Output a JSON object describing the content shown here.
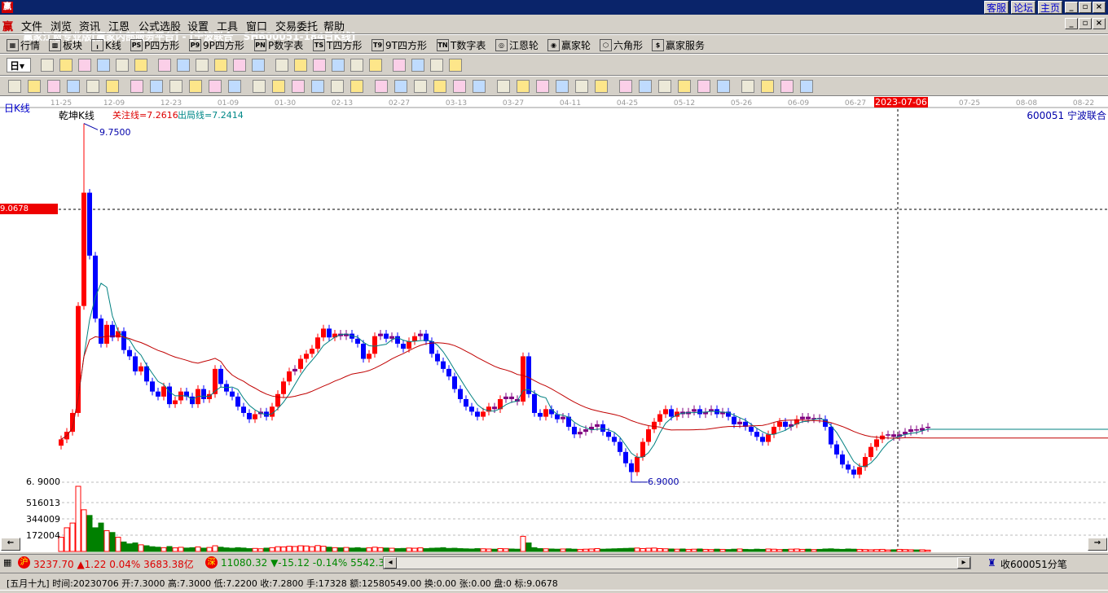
{
  "title": {
    "text": "赢家江恩专业版[赢家内部服务平台] - [宁波联合   SH600051-184日K线]",
    "logo": "赢",
    "links": [
      "客服",
      "论坛",
      "主页"
    ]
  },
  "menu": {
    "logo": "赢",
    "items": [
      "文件",
      "浏览",
      "资讯",
      "江恩",
      "公式选股",
      "设置",
      "工具",
      "窗口",
      "交易委托",
      "帮助"
    ]
  },
  "toolbar1": [
    {
      "icon": "quote-table-icon",
      "label": "行情",
      "tag": "▦"
    },
    {
      "icon": "sector-icon",
      "label": "板块",
      "tag": "▩"
    },
    {
      "icon": "kline-icon",
      "label": "K线",
      "tag": "╻"
    },
    {
      "icon": "p-square-icon",
      "label": "P四方形",
      "tag": "PS"
    },
    {
      "icon": "p9-square-icon",
      "label": "9P四方形",
      "tag": "P9"
    },
    {
      "icon": "p-number-table-icon",
      "label": "P数字表",
      "tag": "PN"
    },
    {
      "icon": "t-square-icon",
      "label": "T四方形",
      "tag": "TS"
    },
    {
      "icon": "t9-square-icon",
      "label": "9T四方形",
      "tag": "T9"
    },
    {
      "icon": "t-number-table-icon",
      "label": "T数字表",
      "tag": "TN"
    },
    {
      "icon": "gann-wheel-icon",
      "label": "江恩轮",
      "tag": "◎"
    },
    {
      "icon": "winner-wheel-icon",
      "label": "赢家轮",
      "tag": "◉"
    },
    {
      "icon": "hexagon-icon",
      "label": "六角形",
      "tag": "⬡"
    },
    {
      "icon": "dollar-icon",
      "label": "赢家服务",
      "tag": "$"
    }
  ],
  "toolbar2_period": "日",
  "chart": {
    "period_label": "日K线",
    "indicator_name": "乾坤K线",
    "focus_line": "关注线=7.2616",
    "exit_line": "出局线=7.2414",
    "stock": "600051  宁波联合",
    "date_ticks": [
      "11-25",
      "12-09",
      "12-23",
      "01-09",
      "01-30",
      "02-13",
      "02-27",
      "03-13",
      "03-27",
      "04-11",
      "04-25",
      "05-12",
      "05-26",
      "06-09",
      "06-27",
      "07-25",
      "08-08",
      "08-22"
    ],
    "cursor_date": "2023-07-06",
    "cursor_price": "9.0678",
    "high_label": "9.7500",
    "low_label": "6.9000",
    "low_axis_label": "6. 9000",
    "volume_ticks": [
      "516013",
      "344009",
      "172004"
    ],
    "colors": {
      "up": "#ff0000",
      "down": "#0000ff",
      "neutral": "#800080",
      "ma_fast": "#008080",
      "ma_slow": "#c00000",
      "vol_up": "#ff0000",
      "vol_down": "#008000"
    }
  },
  "chart_data": {
    "type": "candlestick",
    "title": "宁波联合 SH600051 日K线",
    "ylim": [
      6.9,
      9.75
    ],
    "closes": [
      7.24,
      7.3,
      7.45,
      8.3,
      9.2,
      8.7,
      8.2,
      8.0,
      8.15,
      8.05,
      8.1,
      7.95,
      7.9,
      7.78,
      7.82,
      7.7,
      7.62,
      7.58,
      7.66,
      7.52,
      7.55,
      7.62,
      7.58,
      7.52,
      7.64,
      7.56,
      7.6,
      7.8,
      7.68,
      7.62,
      7.58,
      7.5,
      7.45,
      7.4,
      7.44,
      7.46,
      7.42,
      7.5,
      7.6,
      7.7,
      7.78,
      7.8,
      7.88,
      7.92,
      7.96,
      8.05,
      8.12,
      8.05,
      8.08,
      8.06,
      8.08,
      8.04,
      8.0,
      7.88,
      7.92,
      8.06,
      8.08,
      8.04,
      8.06,
      8.0,
      7.96,
      8.02,
      8.06,
      8.08,
      8.02,
      7.92,
      7.86,
      7.8,
      7.74,
      7.64,
      7.56,
      7.5,
      7.46,
      7.42,
      7.46,
      7.5,
      7.48,
      7.56,
      7.58,
      7.56,
      7.54,
      7.9,
      7.6,
      7.45,
      7.42,
      7.48,
      7.44,
      7.4,
      7.42,
      7.34,
      7.28,
      7.3,
      7.32,
      7.34,
      7.36,
      7.3,
      7.26,
      7.22,
      7.14,
      7.05,
      6.98,
      7.1,
      7.22,
      7.32,
      7.38,
      7.44,
      7.48,
      7.42,
      7.46,
      7.44,
      7.46,
      7.48,
      7.44,
      7.46,
      7.48,
      7.44,
      7.46,
      7.42,
      7.36,
      7.38,
      7.34,
      7.3,
      7.26,
      7.22,
      7.28,
      7.34,
      7.38,
      7.34,
      7.36,
      7.4,
      7.42,
      7.4,
      7.41,
      7.4,
      7.34,
      7.2,
      7.12,
      7.04,
      7.0,
      6.96,
      7.02,
      7.1,
      7.18,
      7.24,
      7.27,
      7.28,
      7.26,
      7.28,
      7.3,
      7.32,
      7.31,
      7.33,
      7.34
    ],
    "volumes": [
      150000,
      250000,
      300000,
      688000,
      440000,
      380000,
      250000,
      300000,
      220000,
      200000,
      150000,
      100000,
      80000,
      90000,
      70000,
      60000,
      50000,
      45000,
      40000,
      52000,
      38000,
      44000,
      36000,
      40000,
      48000,
      35000,
      42000,
      60000,
      45000,
      38000,
      34000,
      40000,
      36000,
      30000,
      32000,
      28000,
      35000,
      40000,
      50000,
      48000,
      55000,
      52000,
      60000,
      58000,
      50000,
      62000,
      55000,
      45000,
      40000,
      38000,
      42000,
      36000,
      40000,
      34000,
      38000,
      45000,
      40000,
      36000,
      34000,
      30000,
      32000,
      36000,
      34000,
      38000,
      30000,
      34000,
      36000,
      40000,
      32000,
      34000,
      30000,
      28000,
      26000,
      30000,
      28000,
      26000,
      24000,
      30000,
      28000,
      26000,
      24000,
      160000,
      90000,
      40000,
      30000,
      28000,
      26000,
      24000,
      26000,
      28000,
      24000,
      22000,
      24000,
      26000,
      30000,
      24000,
      26000,
      28000,
      30000,
      32000,
      34000,
      36000,
      30000,
      34000,
      36000,
      30000,
      28000,
      26000,
      24000,
      26000,
      22000,
      24000,
      26000,
      22000,
      20000,
      24000,
      22000,
      20000,
      24000,
      26000,
      22000,
      20000,
      24000,
      22000,
      26000,
      24000,
      20000,
      22000,
      24000,
      26000,
      22000,
      24000,
      20000,
      22000,
      26000,
      28000,
      24000,
      22000,
      26000,
      24000,
      22000,
      20000,
      18000,
      20000,
      22000,
      16000,
      18000,
      22000,
      20000,
      18000,
      16000,
      18000,
      14000
    ]
  },
  "index_bar": {
    "sh_tag": "沪",
    "sh": "3237.70 ▲1.22 0.04% 3683.38亿",
    "sz_tag": "深",
    "sz": "11080.32 ▼-15.12 -0.14% 5542.3",
    "receiving": "收600051分笔"
  },
  "status": "[五月十九] 时间:20230706 开:7.3000 高:7.3000 低:7.2200 收:7.2800 手:17328 额:12580549.00 换:0.00 张:0.00 盘:0 标:9.0678"
}
